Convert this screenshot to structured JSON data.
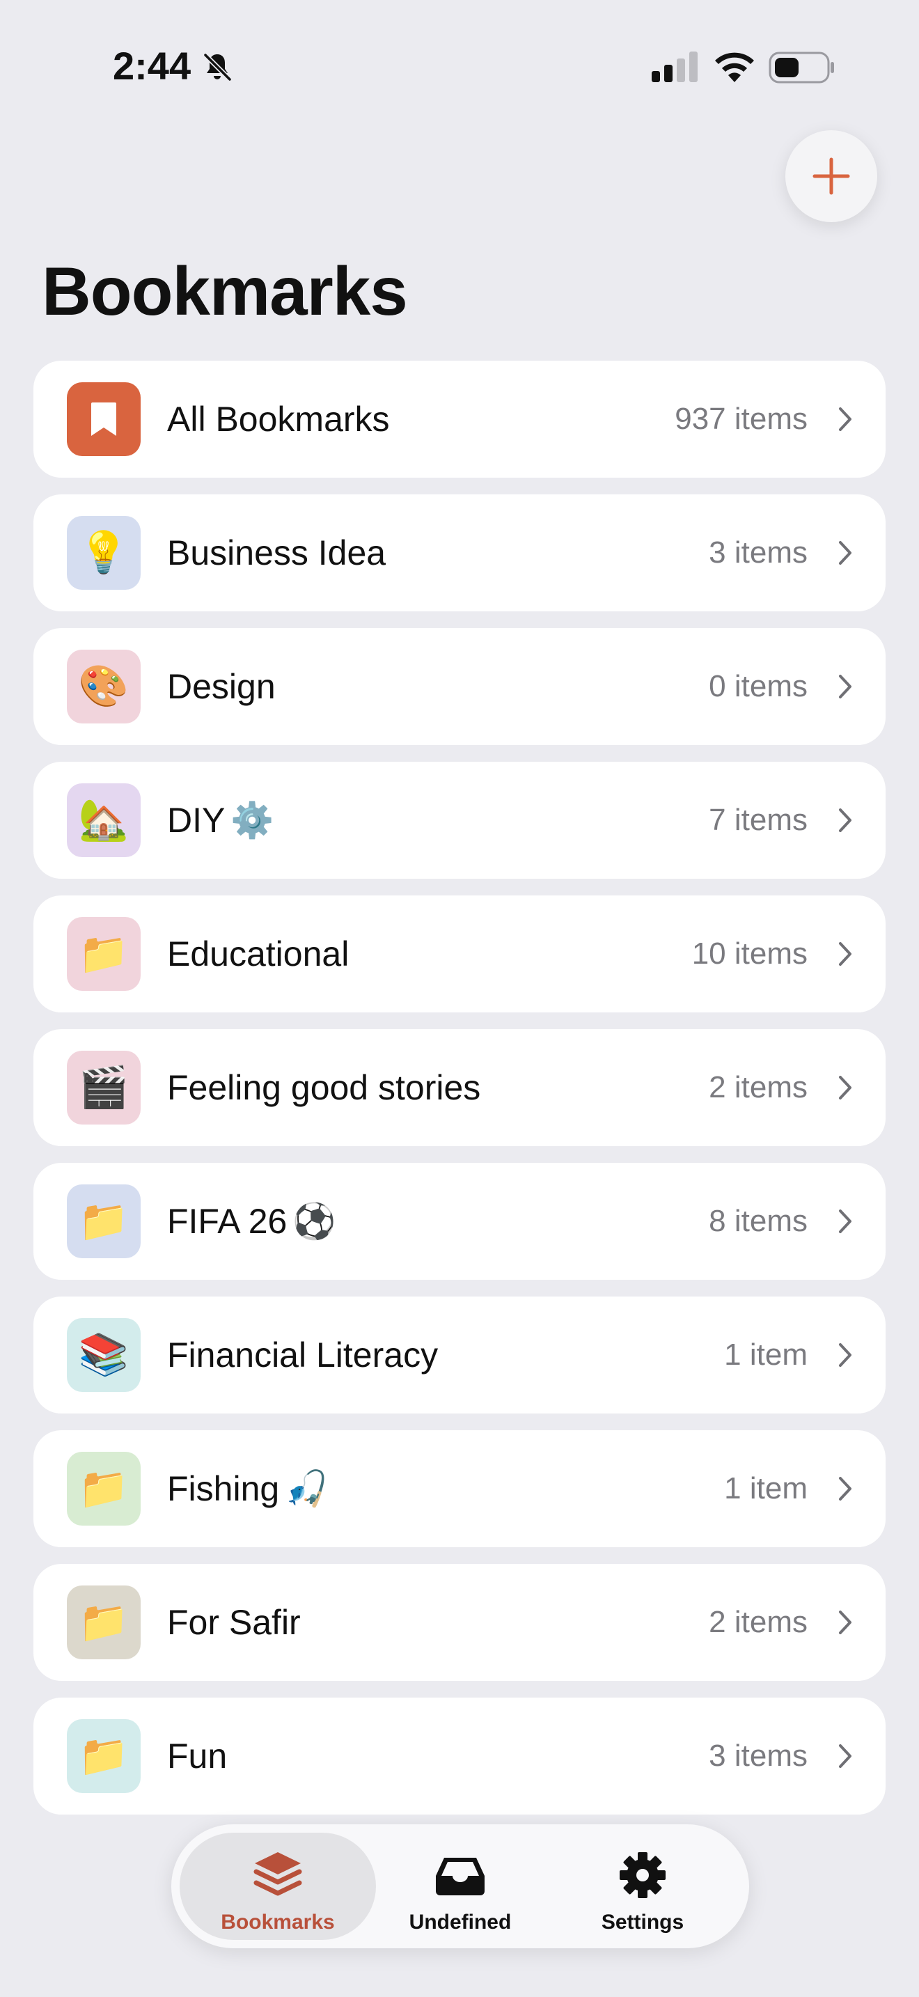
{
  "status_bar": {
    "time": "2:44"
  },
  "header": {
    "title": "Bookmarks"
  },
  "bookmarks": [
    {
      "label": "All Bookmarks",
      "emoji": "",
      "count": "937 items",
      "icon": "bookmark-icon",
      "icon_bg": "#d9643f"
    },
    {
      "label": "Business Idea",
      "emoji": "",
      "count": "3 items",
      "icon": "💡",
      "icon_bg": "#d5ddf0"
    },
    {
      "label": "Design",
      "emoji": "",
      "count": "0 items",
      "icon": "🎨",
      "icon_bg": "#f1d4dc"
    },
    {
      "label": "DIY",
      "emoji": "⚙️",
      "count": "7 items",
      "icon": "🏡",
      "icon_bg": "#e4d7f0"
    },
    {
      "label": "Educational",
      "emoji": "",
      "count": "10 items",
      "icon": "📁",
      "icon_bg": "#f1d4dc"
    },
    {
      "label": "Feeling good stories",
      "emoji": "",
      "count": "2 items",
      "icon": "🎬",
      "icon_bg": "#f1d4dc"
    },
    {
      "label": "FIFA 26",
      "emoji": "⚽",
      "count": "8 items",
      "icon": "📁",
      "icon_bg": "#d5ddf0"
    },
    {
      "label": "Financial Literacy",
      "emoji": "",
      "count": "1 item",
      "icon": "📚",
      "icon_bg": "#d3ecec"
    },
    {
      "label": "Fishing",
      "emoji": "🎣",
      "count": "1 item",
      "icon": "📁",
      "icon_bg": "#d8ecd2"
    },
    {
      "label": "For Safir",
      "emoji": "",
      "count": "2 items",
      "icon": "📁",
      "icon_bg": "#dcd8cc"
    },
    {
      "label": "Fun",
      "emoji": "",
      "count": "3 items",
      "icon": "📁",
      "icon_bg": "#d3ecec"
    }
  ],
  "tabs": [
    {
      "label": "Bookmarks",
      "icon": "stack-icon",
      "active": true
    },
    {
      "label": "Undefined",
      "icon": "tray-icon",
      "active": false
    },
    {
      "label": "Settings",
      "icon": "gear-icon",
      "active": false
    }
  ],
  "colors": {
    "accent": "#d9643f",
    "tab_active_text": "#b8503a",
    "background": "#ebebf0"
  }
}
